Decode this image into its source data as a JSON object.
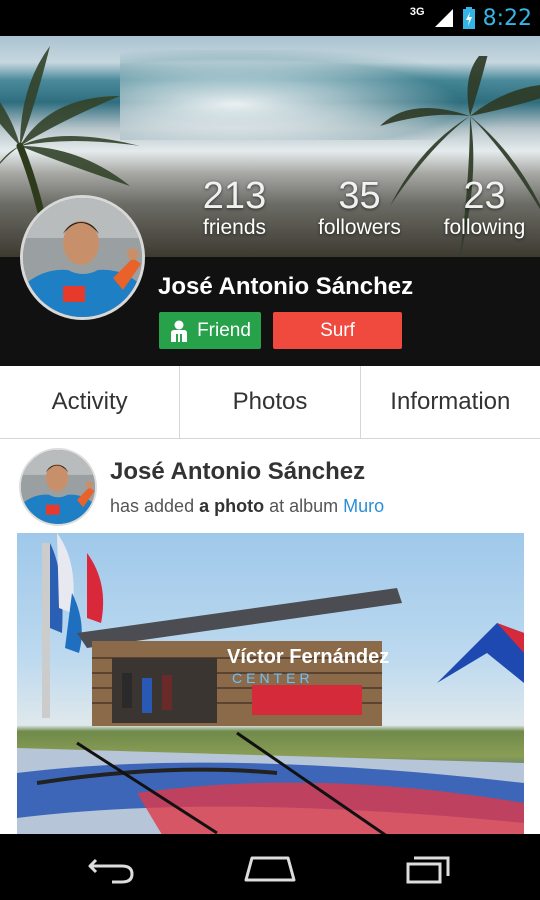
{
  "status_bar": {
    "network": "3G",
    "time": "8:22"
  },
  "profile": {
    "stats": [
      {
        "count": "213",
        "label": "friends"
      },
      {
        "count": "35",
        "label": "followers"
      },
      {
        "count": "23",
        "label": "following"
      }
    ],
    "name": "José Antonio Sánchez",
    "friend_button": "Friend",
    "surf_button": "Surf"
  },
  "tabs": [
    "Activity",
    "Photos",
    "Information"
  ],
  "post": {
    "author": "José Antonio  Sánchez",
    "action_prefix": "has added",
    "action_object": "a photo",
    "action_mid": "at album",
    "album": "Muro",
    "photo_sign": "Víctor Fernández",
    "photo_sign2": "CENTER"
  },
  "colors": {
    "friend": "#27a24a",
    "surf": "#f04a3e",
    "link": "#2b8fd6",
    "clock": "#33b5e5"
  }
}
